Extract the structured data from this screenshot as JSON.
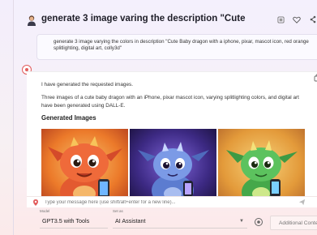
{
  "thread": {
    "title": "generate 3 image varing the description \"Cute",
    "prompt": "generate 3 image varying the colors in description \"Cute Baby dragon with a iphone, pixar, mascot icon, red orange splitlighting, digital art, colly3d\""
  },
  "response": {
    "line1": "I have generated the requested images.",
    "line2": "Three images of a cute baby dragon with an iPhone, pixar mascot icon, varying splitlighting colors, and digital art have been generated using DALL-E.",
    "heading": "Generated Images",
    "images": [
      {
        "name": "red-orange-dragon",
        "bg": "#f08a2c",
        "body": "#e8532e"
      },
      {
        "name": "blue-purple-dragon",
        "bg": "#4c2d8e",
        "body": "#6a8fd8"
      },
      {
        "name": "green-dragon",
        "bg": "#e0a23c",
        "body": "#4cab4e"
      }
    ]
  },
  "composer": {
    "placeholder": "Type your message here (use shift/alt+enter for a new line)..."
  },
  "settings": {
    "model_label": "Model",
    "model_value": "GPT3.5 with Tools",
    "agent_label": "Set as",
    "agent_value": "AI Assistant",
    "context_placeholder": "Additional Context"
  },
  "icons": {
    "avatar": "user-avatar-icon",
    "bookmark": "bookmark-icon",
    "heart": "heart-icon",
    "share": "share-icon",
    "edit": "pencil-icon",
    "copy": "copy-icon",
    "bot": "bot-badge-icon",
    "pin": "pin-icon",
    "send": "send-icon",
    "sidepanel": "side-panel-icon",
    "gear": "gear-icon"
  },
  "colors": {
    "accent_red": "#e25c5c",
    "accent_blue": "#3b82f6"
  }
}
